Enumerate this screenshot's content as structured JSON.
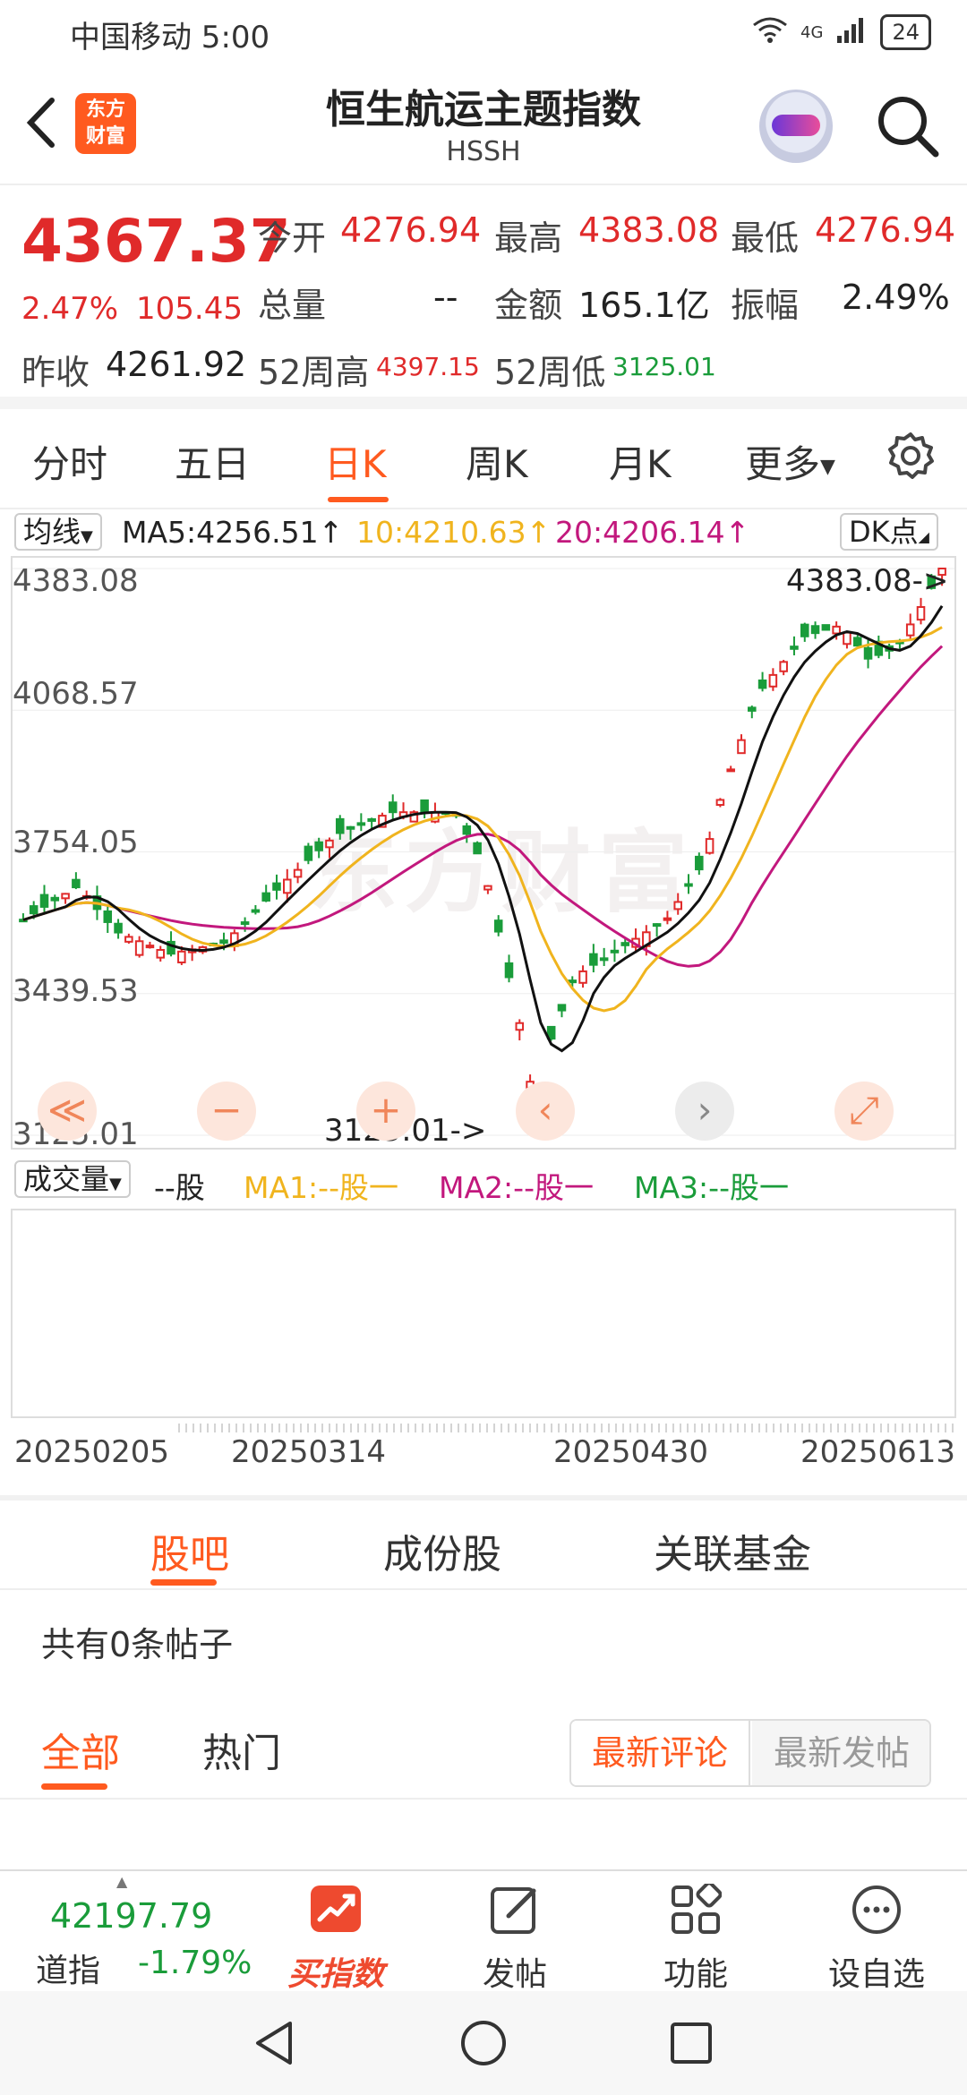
{
  "status": {
    "carrier_time": "中国移动 5:00",
    "network": "4G",
    "battery": "24"
  },
  "header": {
    "title": "恒生航运主题指数",
    "code": "HSSH",
    "logo_line1": "东方",
    "logo_line2": "财富"
  },
  "quote": {
    "price": "4367.37",
    "pct": "2.47%",
    "change": "105.45",
    "open_label": "今开",
    "open": "4276.94",
    "high_label": "最高",
    "high": "4383.08",
    "low_label": "最低",
    "low": "4276.94",
    "volume_label": "总量",
    "volume": "--",
    "amount_label": "金额",
    "amount": "165.1亿",
    "amp_label": "振幅",
    "amp": "2.49%",
    "prev_label": "昨收",
    "prev": "4261.92",
    "w52h_label": "52周高",
    "w52h": "4397.15",
    "w52l_label": "52周低",
    "w52l": "3125.01"
  },
  "tabs": [
    "分时",
    "五日",
    "日K",
    "周K",
    "月K",
    "更多"
  ],
  "ma": {
    "selector": "均线",
    "ma5": "MA5:4256.51↑",
    "ma10": "10:4210.63↑",
    "ma20": "20:4206.14↑",
    "dk": "DK点"
  },
  "chart": {
    "y_labels": [
      "4383.08",
      "4068.57",
      "3754.05",
      "3439.53",
      "3125.01"
    ],
    "high_marker": "4383.08->",
    "low_marker": "3125.01->",
    "watermark": "东方财富",
    "colors": {
      "up": "#e02a2a",
      "down": "#1a9c3a",
      "ma5": "#111111",
      "ma10": "#f0b41e",
      "ma20": "#c2187d"
    }
  },
  "controls": [
    "≪",
    "−",
    "+",
    "‹",
    "›",
    "⤢"
  ],
  "volume": {
    "selector": "成交量",
    "unit": "--股",
    "ma1": "MA1:--股一",
    "ma2": "MA2:--股一",
    "ma3": "MA3:--股一"
  },
  "x_dates": [
    "20250205",
    "20250314",
    "20250430",
    "20250613"
  ],
  "sub_tabs": [
    "股吧",
    "成份股",
    "关联基金"
  ],
  "posts": {
    "count_text": "共有0条帖子"
  },
  "filters": {
    "all": "全部",
    "hot": "热门",
    "latest_comment": "最新评论",
    "latest_post": "最新发帖"
  },
  "bottom_nav": {
    "index_value": "42197.79",
    "index_name": "道指",
    "index_pct": "-1.79%",
    "buy": "买指数",
    "post": "发帖",
    "func": "功能",
    "watch": "设自选"
  }
}
